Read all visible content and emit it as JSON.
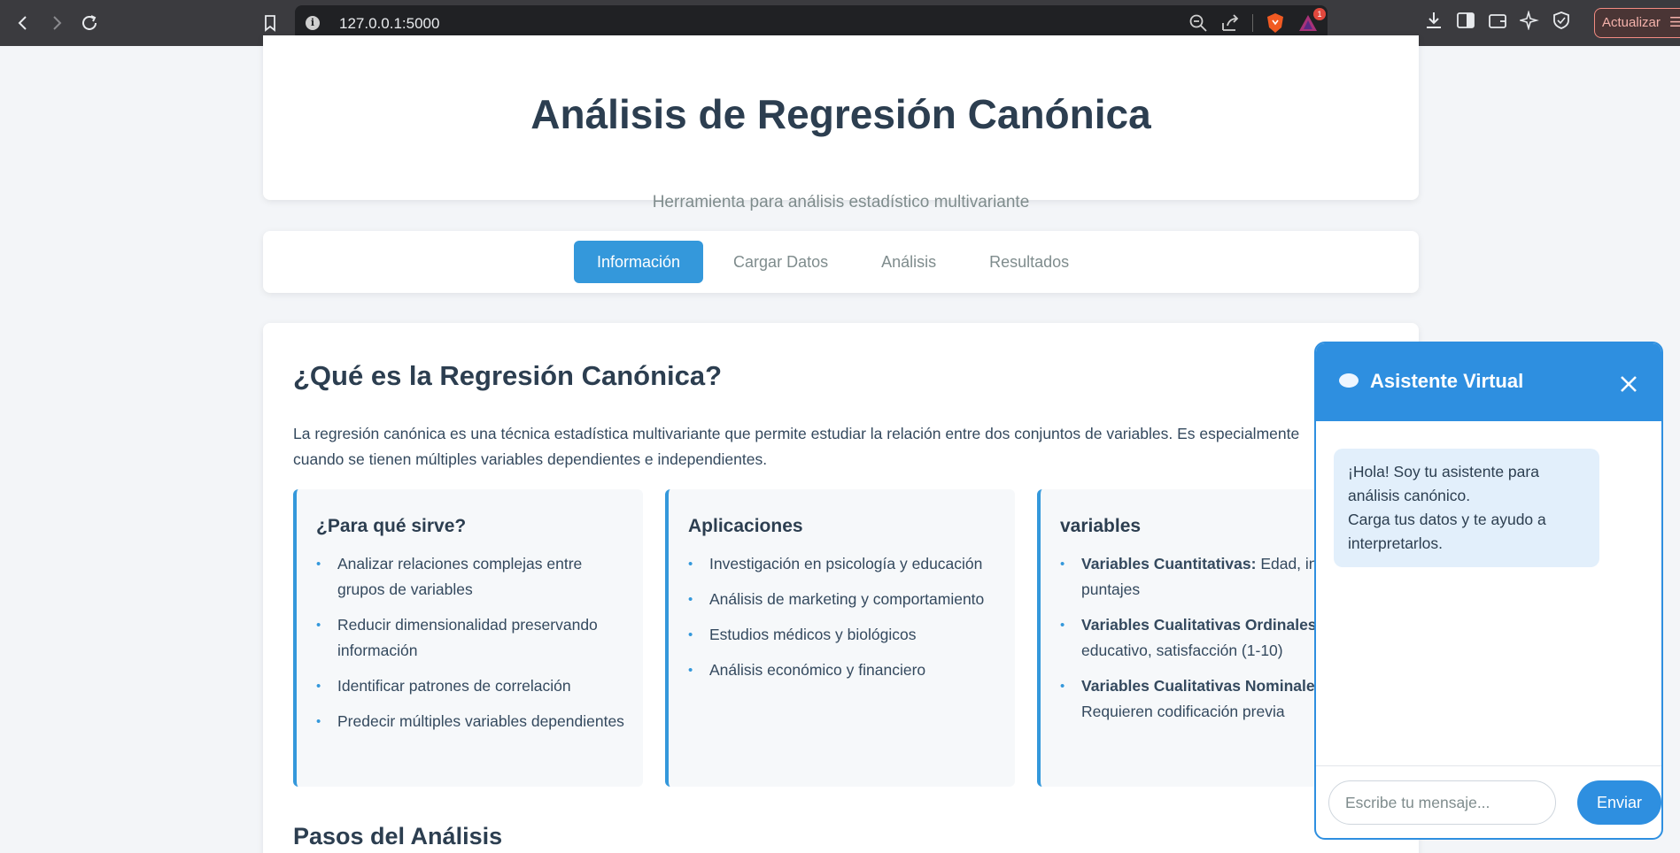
{
  "browser": {
    "url": "127.0.0.1:5000",
    "update_label": "Actualizar",
    "notification_count": "1"
  },
  "header": {
    "title": "Análisis de Regresión Canónica",
    "subtitle": "Herramienta para análisis estadístico multivariante"
  },
  "tabs": [
    {
      "label": "Información",
      "active": true
    },
    {
      "label": "Cargar Datos",
      "active": false
    },
    {
      "label": "Análisis",
      "active": false
    },
    {
      "label": "Resultados",
      "active": false
    }
  ],
  "content": {
    "title": "¿Qué es la Regresión Canónica?",
    "intro_line1": "La regresión canónica es una técnica estadística multivariante que permite estudiar la relación entre dos conjuntos de variables. Es especialmente",
    "intro_line2": "cuando se tienen múltiples variables dependientes e independientes.",
    "boxes": [
      {
        "title": "¿Para qué sirve?",
        "items": [
          "Analizar relaciones complejas entre grupos de variables",
          "Reducir dimensionalidad preservando información",
          "Identificar patrones de correlación",
          "Predecir múltiples variables dependientes"
        ]
      },
      {
        "title": "Aplicaciones",
        "items": [
          "Investigación en psicología y educación",
          "Análisis de marketing y comportamiento",
          "Estudios médicos y biológicos",
          "Análisis económico y financiero"
        ]
      },
      {
        "title": "variables",
        "items": [
          {
            "bold": "Variables Cuantitativas:",
            "text": " Edad, in puntajes"
          },
          {
            "bold": "Variables Cualitativas Ordinales",
            "text": " educativo, satisfacción (1-10)"
          },
          {
            "bold": "Variables Cualitativas Nominale",
            "text": " Requieren codificación previa"
          }
        ]
      }
    ],
    "steps_title": "Pasos del Análisis"
  },
  "chat": {
    "title": "Asistente Virtual",
    "bot_line1": "¡Hola! Soy tu asistente para análisis canónico.",
    "bot_line2": "Carga tus datos y te ayudo a interpretarlos.",
    "input_placeholder": "Escribe tu mensaje...",
    "send_label": "Enviar"
  },
  "colors": {
    "accent": "#3498db",
    "chat_accent": "#2e8fe0",
    "heading": "#2c3e50"
  }
}
